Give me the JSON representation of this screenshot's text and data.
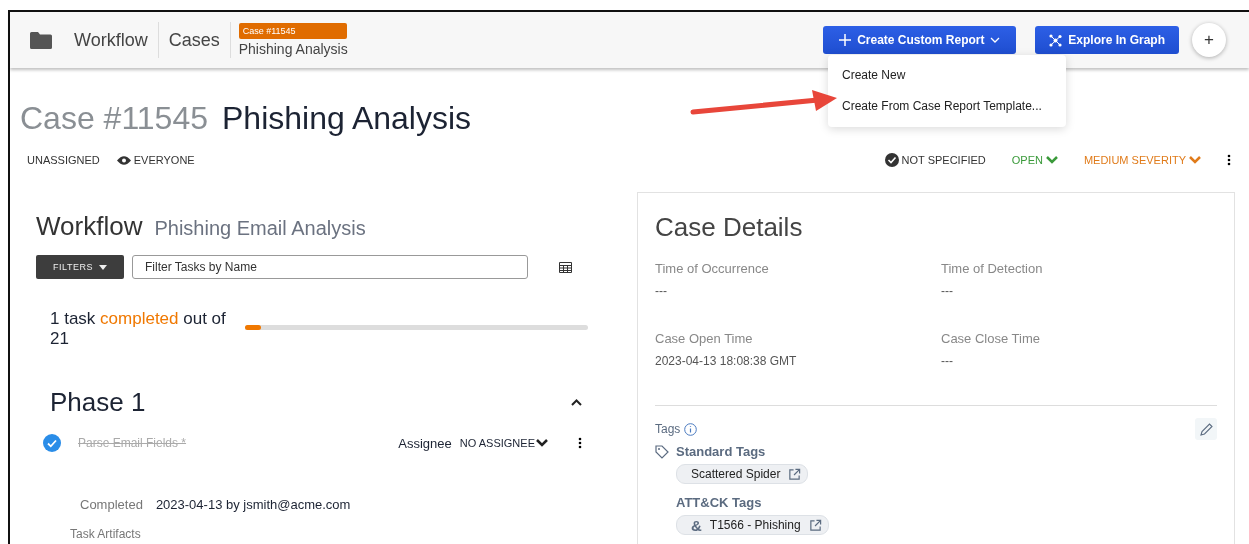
{
  "header": {
    "crumbs": [
      "Workflow",
      "Cases"
    ],
    "case_badge": "Case #11545",
    "case_name": "Phishing Analysis",
    "buttons": [
      {
        "kind": "report",
        "label": "Create Custom Report"
      },
      {
        "kind": "graph",
        "label": "Explore In Graph"
      },
      {
        "kind": "add",
        "label": "+"
      }
    ]
  },
  "menu": {
    "items": [
      {
        "label": "Create New"
      },
      {
        "label": "Create From Case Report Template..."
      }
    ]
  },
  "title": {
    "number": "Case #11545",
    "name": "Phishing Analysis"
  },
  "meta": {
    "assignee": "UNASSIGNED",
    "visibility": "EVERYONE",
    "resolution": "NOT SPECIFIED",
    "status": "OPEN",
    "severity": "MEDIUM SEVERITY"
  },
  "workflow": {
    "title": "Workflow",
    "subtitle": "Phishing Email Analysis",
    "filters_label": "FILTERS",
    "search": {
      "placeholder": "Filter Tasks by Name"
    },
    "progress": {
      "before": "1 task",
      "highlight": "completed",
      "after": "out of 21",
      "level": 0.048
    },
    "phase": {
      "title": "Phase 1",
      "expanded": true,
      "tasks": [
        {
          "name": "Parse Email Fields *",
          "completed": true,
          "assignee_label": "Assignee",
          "assignee": "NO ASSIGNEE",
          "completed_label": "Completed",
          "completed_text": "2023-04-13 by jsmith@acme.com"
        }
      ],
      "artifacts_label": "Task Artifacts"
    }
  },
  "case_details": {
    "title": "Case Details",
    "fields": [
      {
        "label": "Time of Occurrence",
        "value": "---"
      },
      {
        "label": "Time of Detection",
        "value": "---"
      },
      {
        "label": "Case Open Time",
        "value": "2023-04-13 18:08:38 GMT"
      },
      {
        "label": "Case Close Time",
        "value": "---"
      }
    ],
    "tags_label": "Tags",
    "groups": [
      {
        "kind": "standard",
        "title": "Standard Tags",
        "tags": [
          {
            "label": "Scattered Spider"
          }
        ]
      },
      {
        "kind": "attack",
        "title": "ATT&CK Tags",
        "tags": [
          {
            "symbol": "&",
            "label": "T1566 - Phishing"
          }
        ]
      }
    ]
  }
}
